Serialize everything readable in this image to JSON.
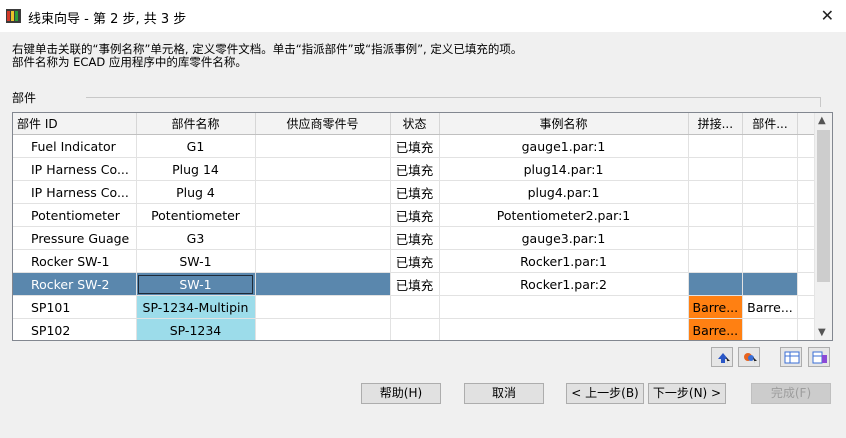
{
  "window": {
    "title": "线束向导 - 第 2 步, 共 3 步"
  },
  "description": "右键单击关联的“事例名称”单元格, 定义零件文档。单击“指派部件”或“指派事例”, 定义已填充的项。\n部件名称为 ECAD 应用程序中的库零件名称。",
  "group": {
    "label": "部件"
  },
  "table": {
    "headers": [
      "部件 ID",
      "部件名称",
      "供应商零件号",
      "状态",
      "事例名称",
      "拼接...",
      "部件...",
      ""
    ],
    "rows": [
      {
        "id": "Fuel Indicator",
        "name": "G1",
        "vendor": "",
        "status": "已填充",
        "instance": "gauge1.par:1",
        "splice": "",
        "part": ""
      },
      {
        "id": "IP Harness Co...",
        "name": "Plug 14",
        "vendor": "",
        "status": "已填充",
        "instance": "plug14.par:1",
        "splice": "",
        "part": ""
      },
      {
        "id": "IP Harness Co...",
        "name": "Plug 4",
        "vendor": "",
        "status": "已填充",
        "instance": "plug4.par:1",
        "splice": "",
        "part": ""
      },
      {
        "id": "Potentiometer",
        "name": "Potentiometer",
        "vendor": "",
        "status": "已填充",
        "instance": "Potentiometer2.par:1",
        "splice": "",
        "part": ""
      },
      {
        "id": "Pressure Guage",
        "name": "G3",
        "vendor": "",
        "status": "已填充",
        "instance": "gauge3.par:1",
        "splice": "",
        "part": ""
      },
      {
        "id": "Rocker SW-1",
        "name": "SW-1",
        "vendor": "",
        "status": "已填充",
        "instance": "Rocker1.par:1",
        "splice": "",
        "part": ""
      },
      {
        "id": "Rocker SW-2",
        "name": "SW-1",
        "vendor": "",
        "status": "已填充",
        "instance": "Rocker1.par:2",
        "splice": "",
        "part": ""
      },
      {
        "id": "SP101",
        "name": "SP-1234-Multipin",
        "vendor": "",
        "status": "",
        "instance": "",
        "splice": "Barre...",
        "part": "Barre..."
      },
      {
        "id": "SP102",
        "name": "SP-1234",
        "vendor": "",
        "status": "",
        "instance": "",
        "splice": "Barre...",
        "part": ""
      }
    ]
  },
  "buttons": {
    "help": "帮助(H)",
    "cancel": "取消",
    "back": "< 上一步(B)",
    "next": "下一步(N) >",
    "finish": "完成(F)"
  },
  "colors": {
    "selected_row": "#5a87ad",
    "cyan_cell": "#9cdcea",
    "orange_cell": "#ff8012"
  },
  "icons": [
    "assign-part-icon",
    "assign-instance-icon",
    "table-view-icon",
    "table-settings-icon"
  ]
}
